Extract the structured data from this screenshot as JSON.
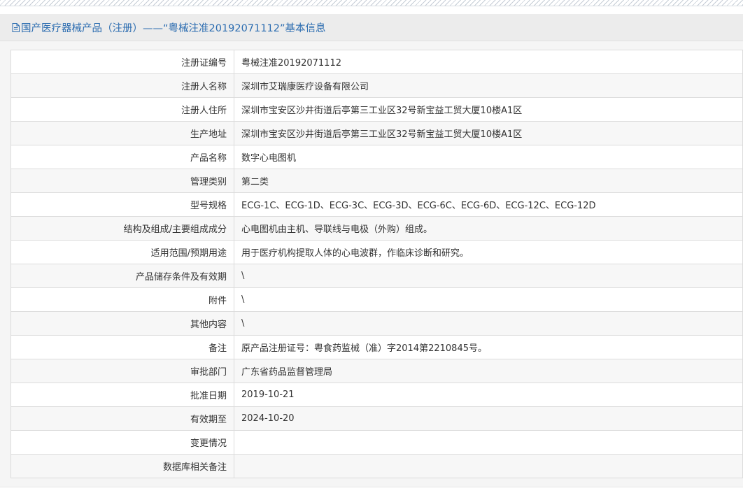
{
  "header": {
    "title": "国产医疗器械产品（注册）——“粤械注准20192071112”基本信息",
    "icon": "document-icon"
  },
  "rows": [
    {
      "label": "注册证编号",
      "value": "粤械注准20192071112"
    },
    {
      "label": "注册人名称",
      "value": "深圳市艾瑞康医疗设备有限公司"
    },
    {
      "label": "注册人住所",
      "value": "深圳市宝安区沙井街道后亭第三工业区32号新宝益工贸大厦10楼A1区"
    },
    {
      "label": "生产地址",
      "value": "深圳市宝安区沙井街道后亭第三工业区32号新宝益工贸大厦10楼A1区"
    },
    {
      "label": "产品名称",
      "value": "数字心电图机"
    },
    {
      "label": "管理类别",
      "value": "第二类"
    },
    {
      "label": "型号规格",
      "value": "ECG-1C、ECG-1D、ECG-3C、ECG-3D、ECG-6C、ECG-6D、ECG-12C、ECG-12D"
    },
    {
      "label": "结构及组成/主要组成成分",
      "value": "心电图机由主机、导联线与电极（外购）组成。"
    },
    {
      "label": "适用范围/预期用途",
      "value": "用于医疗机构提取人体的心电波群，作临床诊断和研究。"
    },
    {
      "label": "产品储存条件及有效期",
      "value": "\\"
    },
    {
      "label": "附件",
      "value": "\\"
    },
    {
      "label": "其他内容",
      "value": "\\"
    },
    {
      "label": "备注",
      "value": "原产品注册证号：粤食药监械（准）字2014第2210845号。"
    },
    {
      "label": "审批部门",
      "value": "广东省药品监督管理局"
    },
    {
      "label": "批准日期",
      "value": "2019-10-21"
    },
    {
      "label": "有效期至",
      "value": "2024-10-20"
    },
    {
      "label": "变更情况",
      "value": ""
    },
    {
      "label": "数据库相关备注",
      "value": ""
    }
  ]
}
